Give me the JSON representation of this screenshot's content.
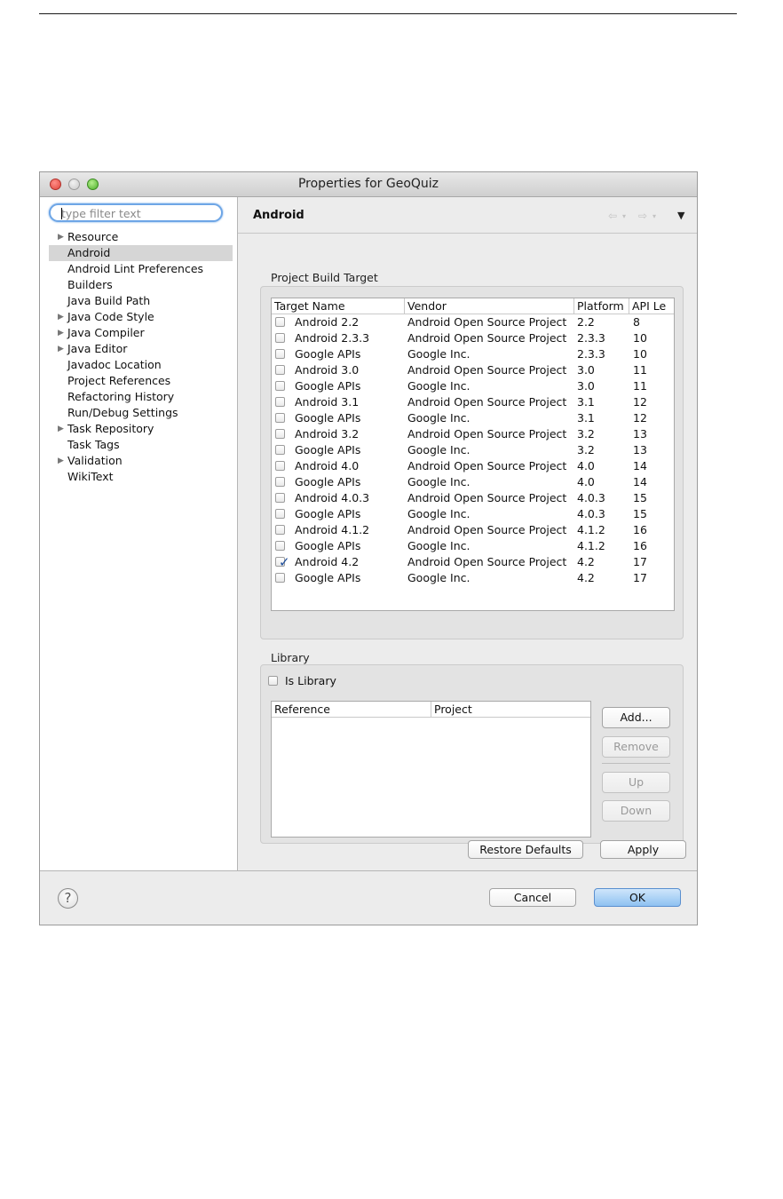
{
  "window": {
    "title": "Properties for GeoQuiz"
  },
  "sidebar": {
    "filter_placeholder": "type filter text",
    "items": [
      {
        "label": "Resource",
        "expandable": true
      },
      {
        "label": "Android",
        "selected": true
      },
      {
        "label": "Android Lint Preferences"
      },
      {
        "label": "Builders"
      },
      {
        "label": "Java Build Path"
      },
      {
        "label": "Java Code Style",
        "expandable": true
      },
      {
        "label": "Java Compiler",
        "expandable": true
      },
      {
        "label": "Java Editor",
        "expandable": true
      },
      {
        "label": "Javadoc Location"
      },
      {
        "label": "Project References"
      },
      {
        "label": "Refactoring History"
      },
      {
        "label": "Run/Debug Settings"
      },
      {
        "label": "Task Repository",
        "expandable": true
      },
      {
        "label": "Task Tags"
      },
      {
        "label": "Validation",
        "expandable": true
      },
      {
        "label": "WikiText"
      }
    ]
  },
  "main": {
    "title": "Android",
    "build_target": {
      "group_label": "Project Build Target",
      "columns": [
        "Target Name",
        "Vendor",
        "Platform",
        "API Le"
      ],
      "rows": [
        {
          "name": "Android 2.2",
          "vendor": "Android Open Source Project",
          "platform": "2.2",
          "api": "8",
          "checked": false
        },
        {
          "name": "Android 2.3.3",
          "vendor": "Android Open Source Project",
          "platform": "2.3.3",
          "api": "10",
          "checked": false
        },
        {
          "name": "Google APIs",
          "vendor": "Google Inc.",
          "platform": "2.3.3",
          "api": "10",
          "checked": false
        },
        {
          "name": "Android 3.0",
          "vendor": "Android Open Source Project",
          "platform": "3.0",
          "api": "11",
          "checked": false
        },
        {
          "name": "Google APIs",
          "vendor": "Google Inc.",
          "platform": "3.0",
          "api": "11",
          "checked": false
        },
        {
          "name": "Android 3.1",
          "vendor": "Android Open Source Project",
          "platform": "3.1",
          "api": "12",
          "checked": false
        },
        {
          "name": "Google APIs",
          "vendor": "Google Inc.",
          "platform": "3.1",
          "api": "12",
          "checked": false
        },
        {
          "name": "Android 3.2",
          "vendor": "Android Open Source Project",
          "platform": "3.2",
          "api": "13",
          "checked": false
        },
        {
          "name": "Google APIs",
          "vendor": "Google Inc.",
          "platform": "3.2",
          "api": "13",
          "checked": false
        },
        {
          "name": "Android 4.0",
          "vendor": "Android Open Source Project",
          "platform": "4.0",
          "api": "14",
          "checked": false
        },
        {
          "name": "Google APIs",
          "vendor": "Google Inc.",
          "platform": "4.0",
          "api": "14",
          "checked": false
        },
        {
          "name": "Android 4.0.3",
          "vendor": "Android Open Source Project",
          "platform": "4.0.3",
          "api": "15",
          "checked": false
        },
        {
          "name": "Google APIs",
          "vendor": "Google Inc.",
          "platform": "4.0.3",
          "api": "15",
          "checked": false
        },
        {
          "name": "Android 4.1.2",
          "vendor": "Android Open Source Project",
          "platform": "4.1.2",
          "api": "16",
          "checked": false
        },
        {
          "name": "Google APIs",
          "vendor": "Google Inc.",
          "platform": "4.1.2",
          "api": "16",
          "checked": false
        },
        {
          "name": "Android 4.2",
          "vendor": "Android Open Source Project",
          "platform": "4.2",
          "api": "17",
          "checked": true
        },
        {
          "name": "Google APIs",
          "vendor": "Google Inc.",
          "platform": "4.2",
          "api": "17",
          "checked": false
        }
      ]
    },
    "library": {
      "group_label": "Library",
      "is_library_label": "Is Library",
      "is_library_checked": false,
      "columns": [
        "Reference",
        "Project"
      ],
      "buttons": {
        "add": "Add...",
        "remove": "Remove",
        "up": "Up",
        "down": "Down"
      }
    },
    "buttons": {
      "restore_defaults": "Restore Defaults",
      "apply": "Apply"
    }
  },
  "footer": {
    "help_symbol": "?",
    "cancel": "Cancel",
    "ok": "OK"
  },
  "colors": {
    "selection": "#d6d6d6",
    "ok_button": "#8ec1f1",
    "filter_focus": "#6ea6e6"
  }
}
